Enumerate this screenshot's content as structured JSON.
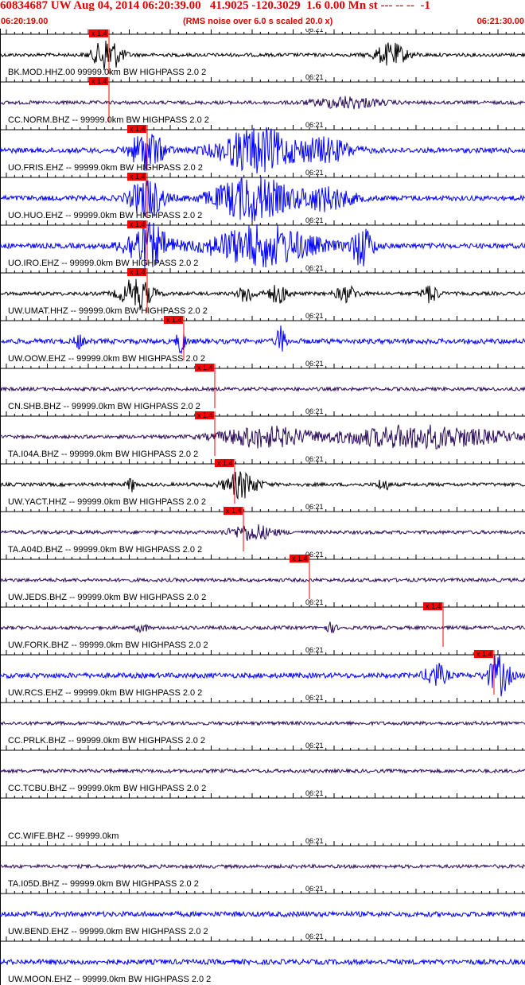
{
  "header": {
    "title": "60834687 UW Aug 04, 2014 06:20:39.00   41.9025 -120.3029  1.6 0.00 Mn st --- -- --  -1",
    "start_time": "06:20:19.00",
    "note": "(RMS noise over 6.0 s scaled 20.0 x)",
    "end_time": "06:21:30.00"
  },
  "minute_label": "06:21",
  "pick_label": "x 1.4",
  "colors": {
    "header": "#e00000",
    "pick": "#ff0000",
    "black": "#000000",
    "blue": "#0000ff",
    "purple": "#2a0a5a"
  },
  "traces": [
    {
      "label": "BK.MOD.HHZ.00 99999.0km BW  HIGHPASS  2.0  2",
      "color": "black",
      "pick": true,
      "bursts": [
        [
          0.205,
          0.8,
          0.025
        ],
        [
          0.745,
          0.5,
          0.03
        ]
      ]
    },
    {
      "label": "CC.NORM.BHZ -- 99999.0km BW  HIGHPASS  2.0  2",
      "color": "purple",
      "pick": true,
      "bursts": [
        [
          0.66,
          0.25,
          0.06
        ]
      ]
    },
    {
      "label": "UO.FRIS.EHZ -- 99999.0km BW  HIGHPASS  2.0  2",
      "color": "blue",
      "pick": true,
      "bursts": [
        [
          0.28,
          0.9,
          0.03
        ],
        [
          0.49,
          1.0,
          0.07
        ],
        [
          0.62,
          0.5,
          0.05
        ]
      ]
    },
    {
      "label": "UO.HUO.EHZ -- 99999.0km BW  HIGHPASS  2.0  2",
      "color": "blue",
      "pick": true,
      "bursts": [
        [
          0.28,
          0.9,
          0.03
        ],
        [
          0.48,
          1.0,
          0.07
        ],
        [
          0.62,
          0.5,
          0.05
        ]
      ]
    },
    {
      "label": "UO.IRO.EHZ -- 99999.0km BW  HIGHPASS  2.0  2",
      "color": "blue",
      "pick": true,
      "bursts": [
        [
          0.28,
          1.0,
          0.04
        ],
        [
          0.5,
          0.9,
          0.1
        ],
        [
          0.69,
          0.9,
          0.02
        ]
      ]
    },
    {
      "label": "UW.UMAT.HHZ -- 99999.0km BW  HIGHPASS  2.0  2",
      "color": "black",
      "pick": true,
      "bursts": [
        [
          0.26,
          0.7,
          0.03
        ],
        [
          0.47,
          0.4,
          0.015
        ],
        [
          0.53,
          0.4,
          0.02
        ],
        [
          0.66,
          0.35,
          0.02
        ],
        [
          0.82,
          0.4,
          0.015
        ]
      ]
    },
    {
      "label": "UW.OOW.EHZ -- 99999.0km BW  HIGHPASS  2.0  2",
      "color": "blue",
      "pick": true,
      "bursts": [
        [
          0.15,
          0.3,
          0.008
        ],
        [
          0.345,
          0.6,
          0.008
        ],
        [
          0.535,
          0.7,
          0.008
        ]
      ]
    },
    {
      "label": "CN.SHB.BHZ -- 99999.0km BW  HIGHPASS  2.0  2",
      "color": "purple",
      "pick": true,
      "bursts": []
    },
    {
      "label": "TA.I04A.BHZ -- 99999.0km BW  HIGHPASS  2.0  2",
      "color": "purple",
      "pick": true,
      "bursts": [
        [
          0.5,
          0.45,
          0.08
        ],
        [
          0.8,
          0.5,
          0.16
        ]
      ]
    },
    {
      "label": "UW.YACT.HHZ -- 99999.0km BW  HIGHPASS  2.0  2",
      "color": "black",
      "pick": true,
      "bursts": [
        [
          0.46,
          0.6,
          0.03
        ],
        [
          0.25,
          0.3,
          0.008
        ],
        [
          0.73,
          0.3,
          0.01
        ]
      ]
    },
    {
      "label": "TA.A04D.BHZ -- 99999.0km BW  HIGHPASS  2.0  2",
      "color": "purple",
      "pick": true,
      "bursts": [
        [
          0.48,
          0.35,
          0.04
        ]
      ]
    },
    {
      "label": "UW.JEDS.BHZ -- 99999.0km BW  HIGHPASS  2.0  2",
      "color": "purple",
      "pick": true,
      "bursts": []
    },
    {
      "label": "UW.FORK.BHZ -- 99999.0km BW  HIGHPASS  2.0  2",
      "color": "purple",
      "pick": true,
      "bursts": [
        [
          0.27,
          0.2,
          0.01
        ],
        [
          0.63,
          0.2,
          0.01
        ]
      ]
    },
    {
      "label": "UW.RCS.EHZ -- 99999.0km BW  HIGHPASS  2.0  2",
      "color": "blue",
      "pick": true,
      "bursts": [
        [
          0.83,
          0.5,
          0.02
        ],
        [
          0.95,
          0.9,
          0.02
        ]
      ]
    },
    {
      "label": "CC.PRLK.BHZ -- 99999.0km BW  HIGHPASS  2.0  2",
      "color": "purple",
      "pick": false,
      "bursts": []
    },
    {
      "label": "CC.TCBU.BHZ -- 99999.0km BW  HIGHPASS  2.0  2",
      "color": "purple",
      "pick": false,
      "bursts": []
    },
    {
      "label": "CC.WIFE.BHZ -- 99999.0km",
      "color": "none",
      "pick": false,
      "bursts": []
    },
    {
      "label": "TA.I05D.BHZ -- 99999.0km BW  HIGHPASS  2.0  2",
      "color": "purple",
      "pick": false,
      "bursts": []
    },
    {
      "label": "UW.BEND.EHZ -- 99999.0km BW  HIGHPASS  2.0  2",
      "color": "blue",
      "pick": false,
      "bursts": []
    },
    {
      "label": "UW.MOON.EHZ -- 99999.0km BW  HIGHPASS  2.0  2",
      "color": "blue",
      "pick": false,
      "bursts": []
    }
  ]
}
